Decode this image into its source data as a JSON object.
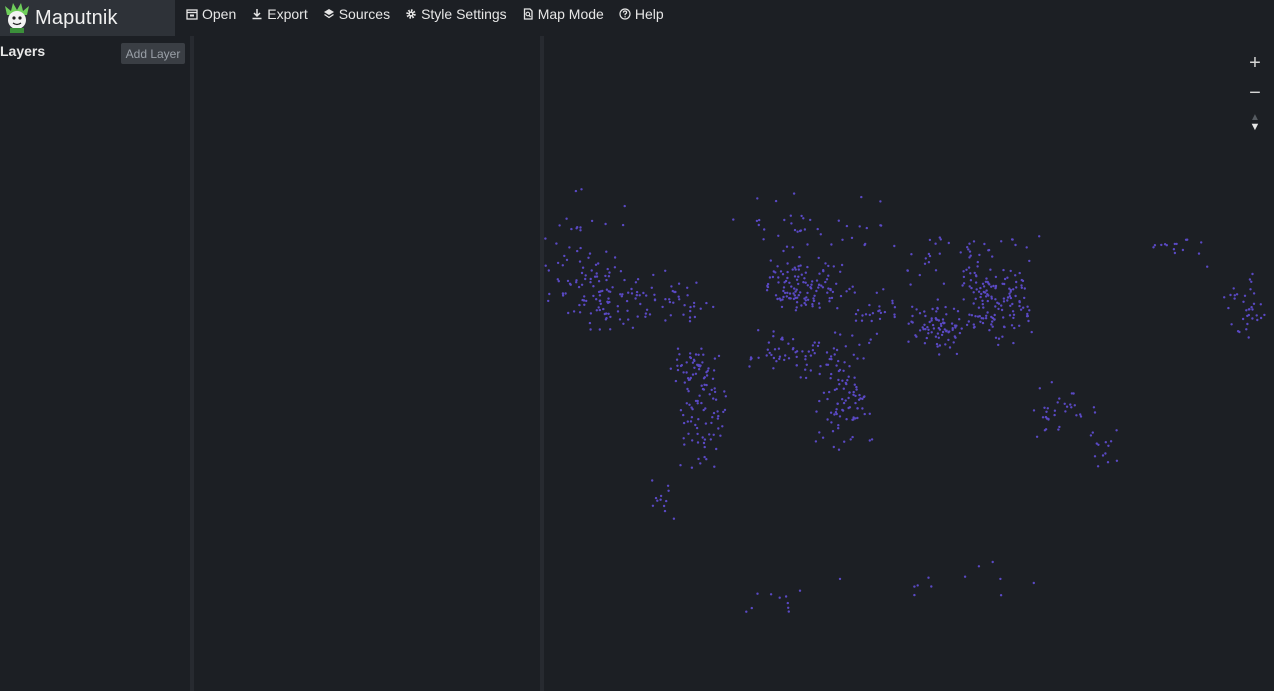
{
  "app": {
    "title": "Maputnik"
  },
  "toolbar": {
    "items": [
      {
        "label": "Open",
        "icon": "open-icon"
      },
      {
        "label": "Export",
        "icon": "download-icon"
      },
      {
        "label": "Sources",
        "icon": "layers-icon"
      },
      {
        "label": "Style Settings",
        "icon": "gear-icon"
      },
      {
        "label": "Map Mode",
        "icon": "map-mode-icon"
      },
      {
        "label": "Help",
        "icon": "help-icon"
      }
    ]
  },
  "layers": {
    "title": "Layers",
    "add_label": "Add Layer"
  },
  "map": {
    "point_color": "#5a49c4",
    "background": "#1c1f24",
    "controls": {
      "zoom_in": "+",
      "zoom_out": "−",
      "compass_up": "▲",
      "compass_down": "▼"
    }
  }
}
